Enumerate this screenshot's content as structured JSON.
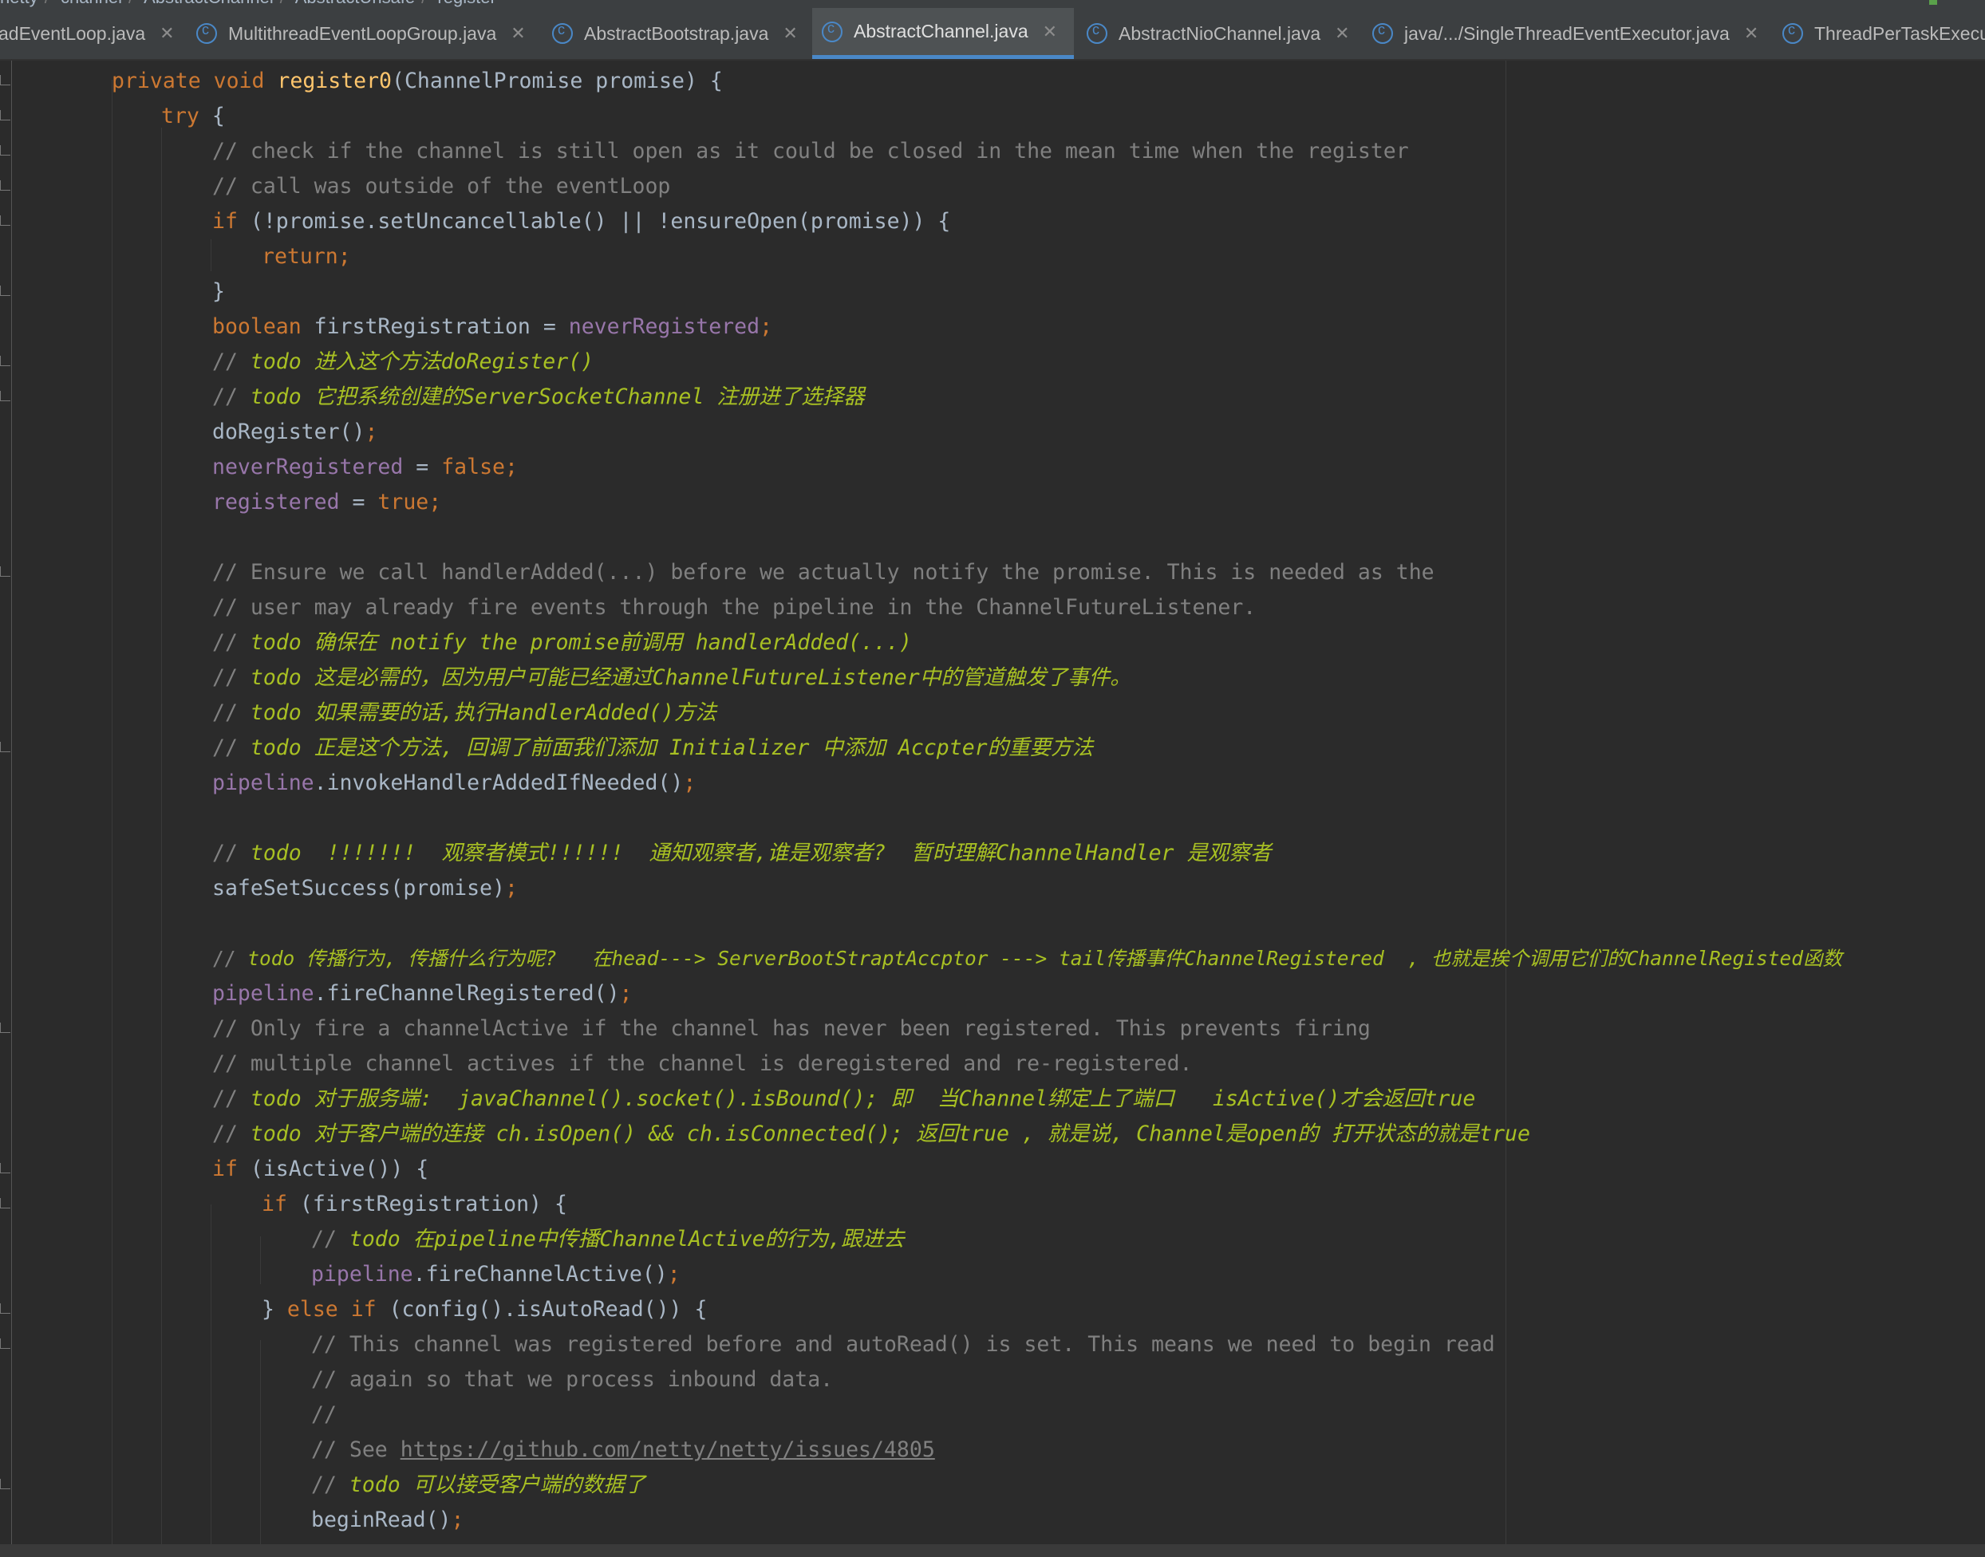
{
  "breadcrumbs": [
    "netty",
    "channel",
    "AbstractChannel",
    "AbstractUnsafe",
    "register"
  ],
  "tabs": [
    {
      "label": "adEventLoop.java",
      "active": false
    },
    {
      "label": "MultithreadEventLoopGroup.java",
      "active": false
    },
    {
      "label": "AbstractBootstrap.java",
      "active": false
    },
    {
      "label": "AbstractChannel.java",
      "active": true
    },
    {
      "label": "AbstractNioChannel.java",
      "active": false
    },
    {
      "label": "java/.../SingleThreadEventExecutor.java",
      "active": false
    },
    {
      "label": "ThreadPerTaskExecu",
      "active": false
    }
  ],
  "colors": {
    "background": "#2b2b2b",
    "keyword": "#cc7832",
    "method_decl": "#ffc66d",
    "field": "#9876aa",
    "comment": "#808080",
    "todo": "#a8c023",
    "active_tab_underline": "#4a88c7"
  },
  "code": {
    "l1": {
      "kw": "private void ",
      "fn": "register0",
      "rest": "(ChannelPromise promise) {"
    },
    "l2": {
      "kw": "try",
      "rest": " {"
    },
    "l3": "// check if the channel is still open as it could be closed in the mean time when the register",
    "l4": "// call was outside of the eventLoop",
    "l5": {
      "kw": "if",
      "rest": " (!promise.setUncancellable() || !ensureOpen(promise)) {"
    },
    "l6": {
      "kw": "return;"
    },
    "l7": "}",
    "l8": {
      "kw": "boolean",
      "rest": " firstRegistration = ",
      "fld": "neverRegistered",
      "semi": ";"
    },
    "l9": {
      "c": "// ",
      "t": "todo 进入这个方法doRegister()"
    },
    "l10": {
      "c": "// ",
      "t": "todo 它把系统创建的ServerSocketChannel 注册进了选择器"
    },
    "l11": {
      "rest": "doRegister()",
      "semi": ";"
    },
    "l12": {
      "fld": "neverRegistered",
      "rest": " = ",
      "kw": "false",
      "semi": ";"
    },
    "l13": {
      "fld": "registered",
      "rest": " = ",
      "kw": "true",
      "semi": ";"
    },
    "l14": "// Ensure we call handlerAdded(...) before we actually notify the promise. This is needed as the",
    "l15": "// user may already fire events through the pipeline in the ChannelFutureListener.",
    "l16": {
      "c": "// ",
      "t": "todo 确保在 notify the promise前调用 handlerAdded(...)"
    },
    "l17": {
      "c": "// ",
      "t": "todo 这是必需的，因为用户可能已经通过ChannelFutureListener中的管道触发了事件。"
    },
    "l18": {
      "c": "// ",
      "t": "todo 如果需要的话,执行HandlerAdded()方法"
    },
    "l19": {
      "c": "// ",
      "t": "todo 正是这个方法, 回调了前面我们添加 Initializer 中添加 Accpter的重要方法"
    },
    "l20": {
      "fld": "pipeline",
      "rest": ".invokeHandlerAddedIfNeeded()",
      "semi": ";"
    },
    "l21": {
      "c": "// ",
      "t": "todo  !!!!!!!  观察者模式!!!!!!  通知观察者,谁是观察者?  暂时理解ChannelHandler 是观察者"
    },
    "l22": {
      "rest": "safeSetSuccess(promise)",
      "semi": ";"
    },
    "l23": {
      "c": "// ",
      "t": "todo 传播行为, 传播什么行为呢?   在head---> ServerBootStraptAccptor ---> tail传播事件ChannelRegistered  , 也就是挨个调用它们的ChannelRegisted函数"
    },
    "l24": {
      "fld": "pipeline",
      "rest": ".fireChannelRegistered()",
      "semi": ";"
    },
    "l25": "// Only fire a channelActive if the channel has never been registered. This prevents firing",
    "l26": "// multiple channel actives if the channel is deregistered and re-registered.",
    "l27": {
      "c": "// ",
      "t": "todo 对于服务端:  javaChannel().socket().isBound(); 即  当Channel绑定上了端口   isActive()才会返回true"
    },
    "l28": {
      "c": "// ",
      "t": "todo 对于客户端的连接 ch.isOpen() && ch.isConnected(); 返回true , 就是说, Channel是open的 打开状态的就是true"
    },
    "l29": {
      "kw": "if",
      "rest": " (isActive()) {"
    },
    "l30": {
      "kw": "if",
      "rest": " (firstRegistration) {"
    },
    "l31": {
      "c": "// ",
      "t": "todo 在pipeline中传播ChannelActive的行为,跟进去"
    },
    "l32": {
      "fld": "pipeline",
      "rest": ".fireChannelActive()",
      "semi": ";"
    },
    "l33": {
      "pre": "} ",
      "kw": "else if",
      "rest": " (config().isAutoRead()) {"
    },
    "l34": "// This channel was registered before and autoRead() is set. This means we need to begin read",
    "l35": "// again so that we process inbound data.",
    "l36": "//",
    "l37": {
      "c": "// See ",
      "url": "https://github.com/netty/netty/issues/4805"
    },
    "l38": {
      "c": "// ",
      "t": "todo 可以接受客户端的数据了"
    },
    "l39": {
      "rest": "beginRead()",
      "semi": ";"
    }
  }
}
